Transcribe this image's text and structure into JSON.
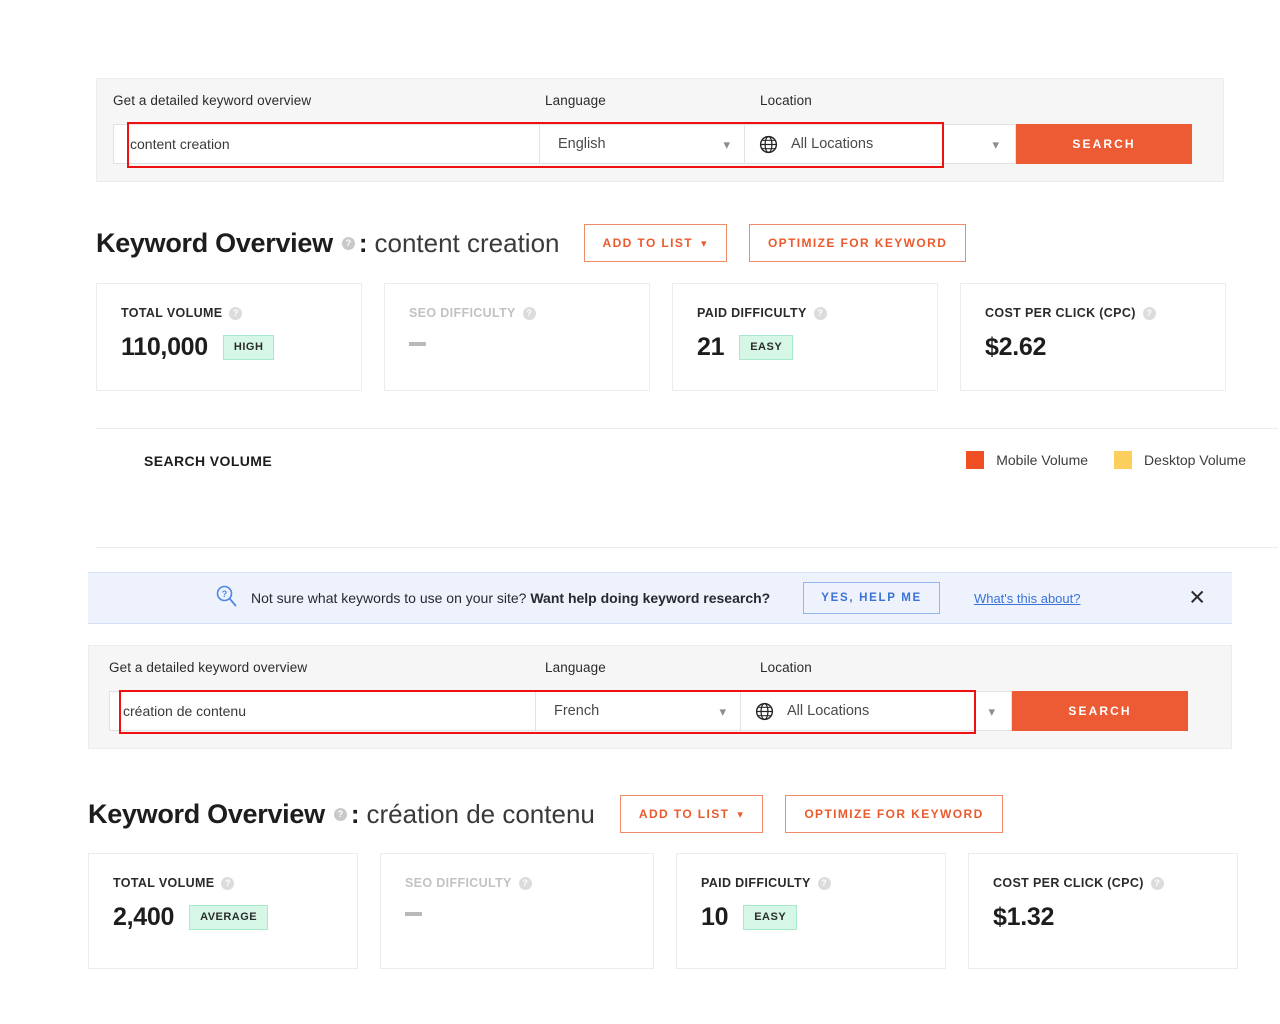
{
  "sections": [
    {
      "search": {
        "keyword_label": "Get a detailed keyword overview",
        "keyword_value": "content creation",
        "language_label": "Language",
        "language_value": "English",
        "location_label": "Location",
        "location_value": "All Locations",
        "search_button": "SEARCH"
      },
      "overview": {
        "title": "Keyword Overview",
        "help": "?",
        "colon": ":",
        "keyword": "content creation",
        "add_to_list": "ADD TO LIST",
        "add_to_list_caret": "⌄",
        "optimize": "OPTIMIZE FOR KEYWORD"
      },
      "cards": [
        {
          "label": "TOTAL VOLUME",
          "value": "110,000",
          "chip": "HIGH",
          "muted": false
        },
        {
          "label": "SEO DIFFICULTY",
          "value": "",
          "chip": "",
          "muted": true
        },
        {
          "label": "PAID DIFFICULTY",
          "value": "21",
          "chip": "EASY",
          "muted": false
        },
        {
          "label": "COST PER CLICK (CPC)",
          "value": "$2.62",
          "chip": "",
          "muted": false
        }
      ]
    },
    {
      "search": {
        "keyword_label": "Get a detailed keyword overview",
        "keyword_value": "création de contenu",
        "language_label": "Language",
        "language_value": "French",
        "location_label": "Location",
        "location_value": "All Locations",
        "search_button": "SEARCH"
      },
      "overview": {
        "title": "Keyword Overview",
        "help": "?",
        "colon": ":",
        "keyword": "création de contenu",
        "add_to_list": "ADD TO LIST",
        "add_to_list_caret": "⌄",
        "optimize": "OPTIMIZE FOR KEYWORD"
      },
      "cards": [
        {
          "label": "TOTAL VOLUME",
          "value": "2,400",
          "chip": "AVERAGE",
          "muted": false
        },
        {
          "label": "SEO DIFFICULTY",
          "value": "",
          "chip": "",
          "muted": true
        },
        {
          "label": "PAID DIFFICULTY",
          "value": "10",
          "chip": "EASY",
          "muted": false
        },
        {
          "label": "COST PER CLICK (CPC)",
          "value": "$1.32",
          "chip": "",
          "muted": false
        }
      ]
    }
  ],
  "search_volume": {
    "title": "SEARCH VOLUME",
    "legend": [
      {
        "label": "Mobile Volume",
        "color": "#f04e23"
      },
      {
        "label": "Desktop Volume",
        "color": "#fcce5c"
      }
    ]
  },
  "banner": {
    "icon": "search-question-icon",
    "text_plain": "Not sure what keywords to use on your site? ",
    "text_bold": "Want help doing keyword research?",
    "help_button": "YES, HELP ME",
    "link": "What's this about?",
    "close": "✕"
  },
  "colors": {
    "accent_orange": "#ec5b33",
    "annotation_red": "#ee1111",
    "chip_green_bg": "#d6f7e6",
    "banner_blue": "#edf2fd",
    "link_blue": "#3a72d8"
  }
}
